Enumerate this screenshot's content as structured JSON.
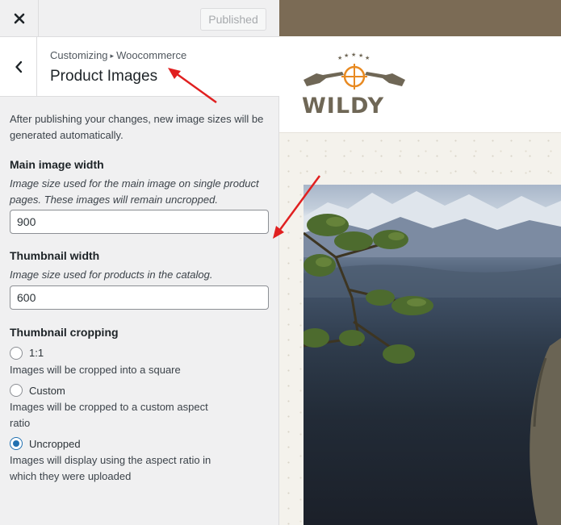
{
  "header": {
    "close_icon": "close-icon",
    "publish_label": "Published"
  },
  "section": {
    "breadcrumb_parent": "Customizing",
    "breadcrumb_separator": "▸",
    "breadcrumb_child": "Woocommerce",
    "title": "Product Images",
    "back_icon": "chevron-left-icon"
  },
  "intro_text": "After publishing your changes, new image sizes will be generated automatically.",
  "main_image": {
    "label": "Main image width",
    "description": "Image size used for the main image on single product pages. These images will remain uncropped.",
    "value": "900"
  },
  "thumbnail": {
    "label": "Thumbnail width",
    "description": "Image size used for products in the catalog.",
    "value": "600"
  },
  "cropping": {
    "label": "Thumbnail cropping",
    "options": [
      {
        "label": "1:1",
        "description": "Images will be cropped into a square",
        "checked": false
      },
      {
        "label": "Custom",
        "description": "Images will be cropped to a custom aspect ratio",
        "checked": false
      },
      {
        "label": "Uncropped",
        "description": "Images will display using the aspect ratio in which they were uploaded",
        "checked": true
      }
    ]
  },
  "preview": {
    "logo_text": "WILDY",
    "colors": {
      "topbar": "#7b6b55",
      "logo_brown": "#6f6756",
      "logo_orange": "#e88a22",
      "annotation_red": "#e02020",
      "accent_blue": "#2271b1"
    }
  }
}
